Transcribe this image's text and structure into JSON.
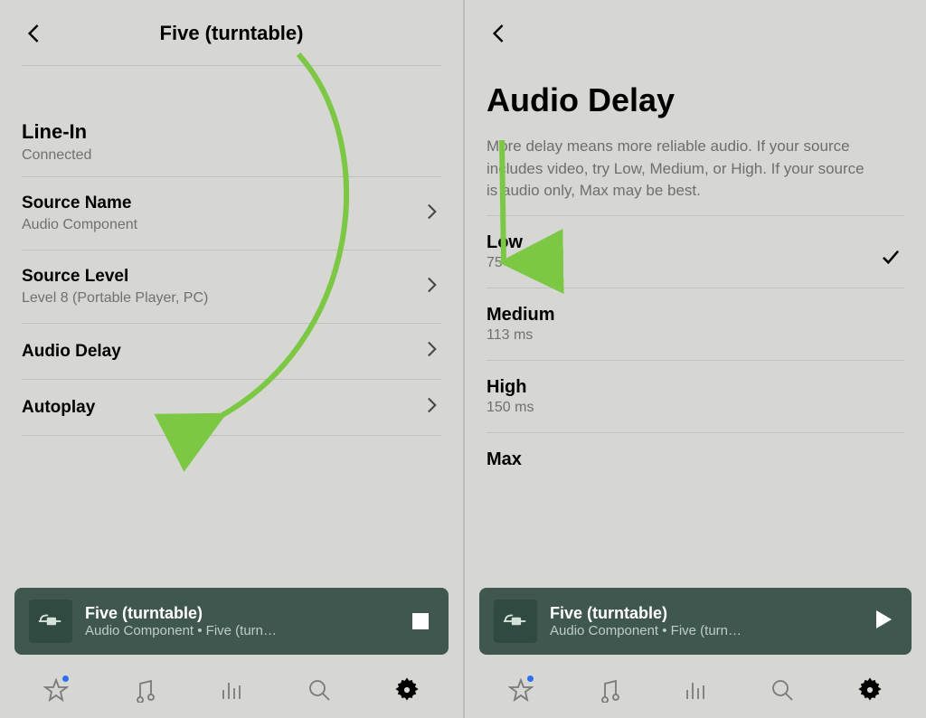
{
  "colors": {
    "annotation_arrow": "#7cc844",
    "np_bg": "#3f574e",
    "np_icon_bg": "#2f4a40"
  },
  "left": {
    "header_title": "Five (turntable)",
    "section": {
      "title": "Line-In",
      "status": "Connected"
    },
    "rows": [
      {
        "label": "Source Name",
        "value": "Audio Component"
      },
      {
        "label": "Source Level",
        "value": "Level 8 (Portable Player, PC)"
      },
      {
        "label": "Audio Delay",
        "value": ""
      },
      {
        "label": "Autoplay",
        "value": ""
      }
    ],
    "now_playing": {
      "title": "Five (turntable)",
      "subtitle": "Audio Component • Five (turn…",
      "control": "stop"
    }
  },
  "right": {
    "page_title": "Audio Delay",
    "description": "More delay means more reliable audio. If your source includes video, try Low, Medium, or High. If your source is audio only, Max may be best.",
    "options": [
      {
        "name": "Low",
        "detail": "75 ms",
        "selected": true
      },
      {
        "name": "Medium",
        "detail": "113 ms",
        "selected": false
      },
      {
        "name": "High",
        "detail": "150 ms",
        "selected": false
      },
      {
        "name": "Max",
        "detail": "",
        "selected": false
      }
    ],
    "now_playing": {
      "title": "Five (turntable)",
      "subtitle": "Audio Component • Five (turn…",
      "control": "play"
    }
  },
  "nav_icons": [
    "star",
    "music",
    "eq",
    "search",
    "settings"
  ],
  "nav_active_index": 4
}
